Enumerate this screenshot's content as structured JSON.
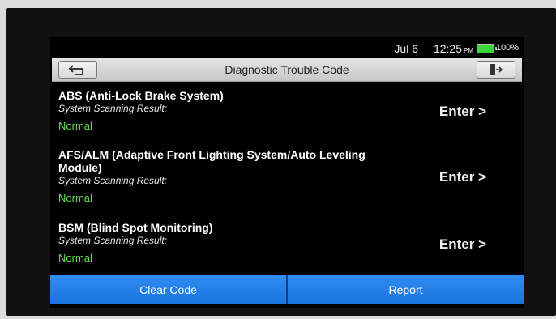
{
  "status": {
    "date": "Jul 6",
    "time": "12:25",
    "ampm": "PM",
    "battery": "100%",
    "battery_color": "#3bd43b"
  },
  "header": {
    "title": "Diagnostic Trouble Code",
    "back_icon": "back-arrow-icon",
    "exit_icon": "exit-door-icon"
  },
  "systems": [
    {
      "name": "ABS (Anti-Lock Brake System)",
      "scan_label": "System Scanning Result:",
      "result": "Normal",
      "action": "Enter >"
    },
    {
      "name_line1": "AFS/ALM (Adaptive Front Lighting System/Auto Leveling",
      "name_line2": "Module)",
      "scan_label": "System Scanning Result:",
      "result": "Normal",
      "action": "Enter >"
    },
    {
      "name": "BSM (Blind Spot Monitoring)",
      "scan_label": "System Scanning Result:",
      "result": "Normal",
      "action": "Enter >"
    }
  ],
  "footer": {
    "clear_code": "Clear Code",
    "report": "Report",
    "button_color": "#1f7ce8"
  },
  "colors": {
    "result_ok": "#66dd55",
    "background": "#000000"
  }
}
